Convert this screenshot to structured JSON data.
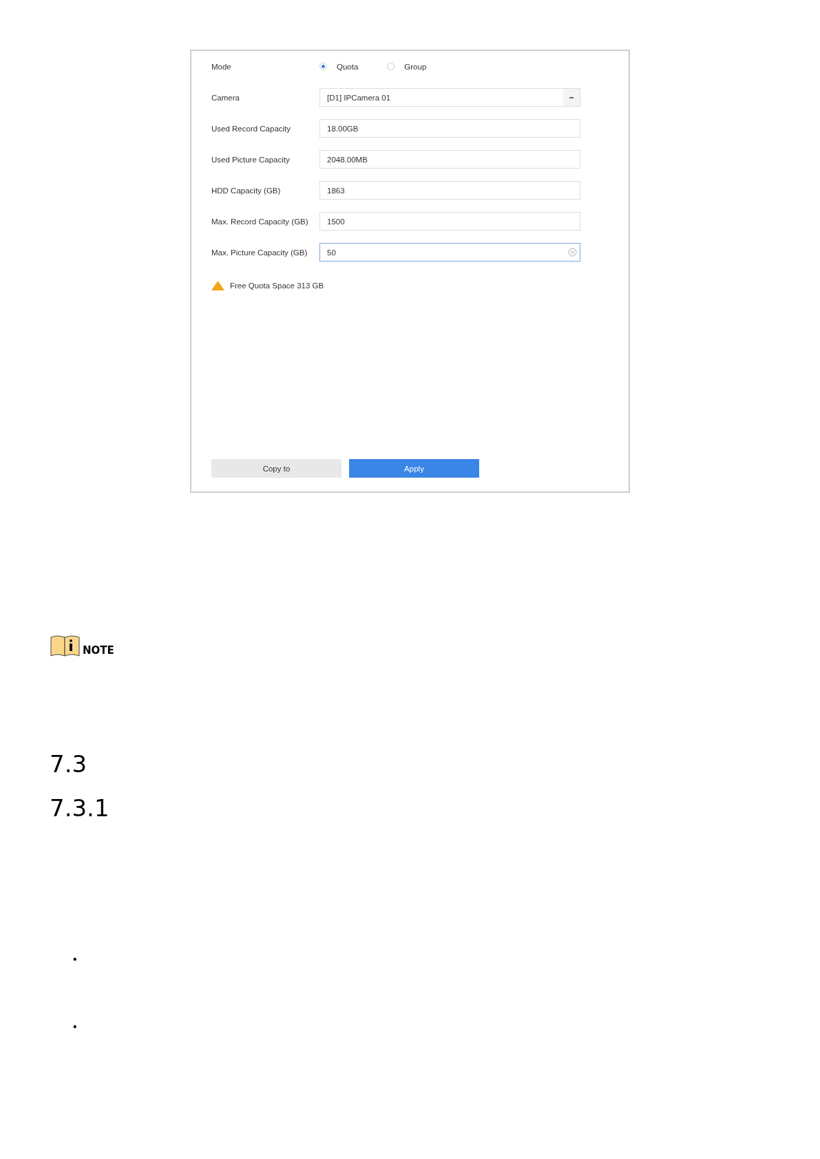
{
  "settings_panel": {
    "mode": {
      "label": "Mode",
      "options": [
        {
          "label": "Quota",
          "selected": true
        },
        {
          "label": "Group",
          "selected": false
        }
      ]
    },
    "fields": [
      {
        "kind": "dropdown",
        "label": "Camera",
        "value": "[D1] IPCamera 01",
        "focused": false
      },
      {
        "kind": "text",
        "label": "Used Record Capacity",
        "value": "18.00GB",
        "focused": false
      },
      {
        "kind": "text",
        "label": "Used Picture Capacity",
        "value": "2048.00MB",
        "focused": false
      },
      {
        "kind": "text",
        "label": "HDD Capacity (GB)",
        "value": "1863",
        "focused": false
      },
      {
        "kind": "text",
        "label": "Max. Record Capacity (GB)",
        "value": "1500",
        "focused": false
      },
      {
        "kind": "text",
        "label": "Max. Picture Capacity (GB)",
        "value": "50",
        "focused": true
      }
    ],
    "warning": "Free Quota Space 313 GB",
    "buttons": [
      {
        "label": "Copy to",
        "primary": false
      },
      {
        "label": "Apply",
        "primary": true
      }
    ]
  },
  "note": {
    "label": "NOTE"
  },
  "headings": [
    "7.3",
    "7.3.1"
  ],
  "bullets": [
    "•",
    "•"
  ]
}
